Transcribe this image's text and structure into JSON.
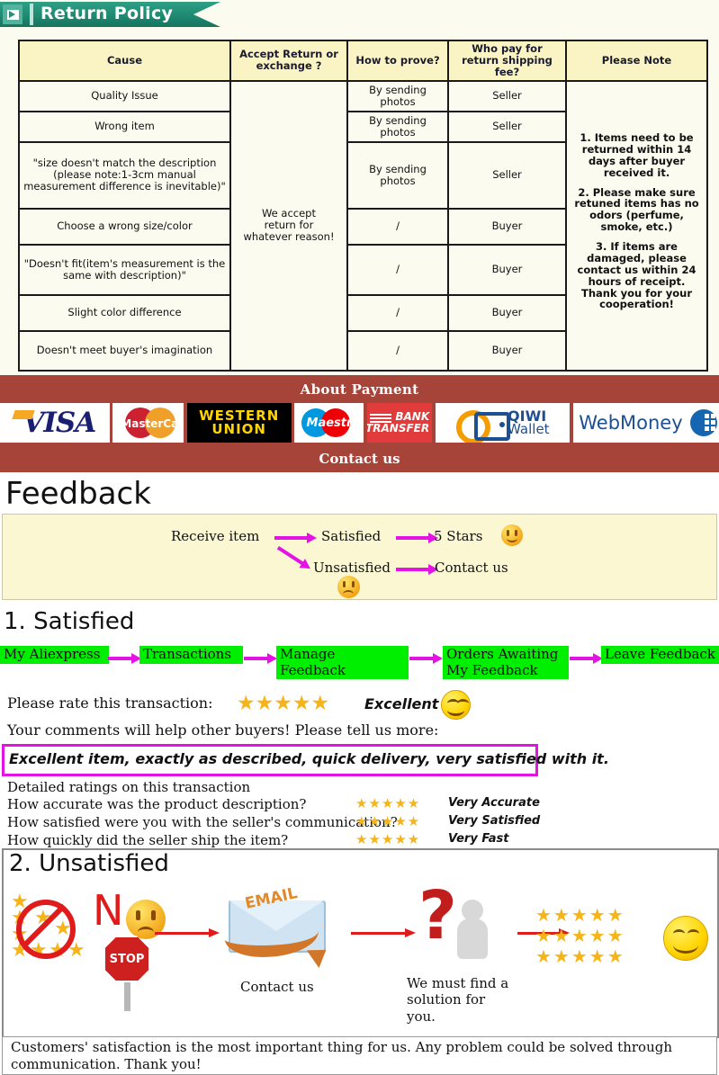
{
  "return_policy": {
    "banner_title": "Return Policy",
    "banner_color": "#1f8a72",
    "table": {
      "headers": [
        "Cause",
        "Accept Return or exchange ?",
        "How to prove?",
        "Who pay for return shipping fee?",
        "Please Note"
      ],
      "accept_cell": "We accept\nreturn for\nwhatever reason!",
      "rows": [
        {
          "cause": "Quality Issue",
          "prove": "By sending photos",
          "who": "Seller"
        },
        {
          "cause": "Wrong item",
          "prove": "By sending photos",
          "who": "Seller"
        },
        {
          "cause": "\"size doesn't match the description (please note:1-3cm manual measurement difference is inevitable)\"",
          "prove": "By sending photos",
          "who": "Seller"
        },
        {
          "cause": "Choose a wrong size/color",
          "prove": "/",
          "who": "Buyer"
        },
        {
          "cause": "\"Doesn't fit(item's measurement is the same with description)\"",
          "prove": "/",
          "who": "Buyer"
        },
        {
          "cause": "Slight color difference",
          "prove": "/",
          "who": "Buyer"
        },
        {
          "cause": "Doesn't meet buyer's imagination",
          "prove": "/",
          "who": "Buyer"
        }
      ],
      "notes": [
        "1. Items need to be returned within 14 days after buyer received it.",
        "2. Please make sure retuned items has no odors (perfume, smoke, etc.)",
        "3. If items are damaged, please contact us within 24 hours of receipt. Thank you for your cooperation!"
      ]
    }
  },
  "payment": {
    "title": "About Payment",
    "contact_title": "Contact us",
    "band_color": "#a7443a",
    "methods": [
      {
        "name": "VISA"
      },
      {
        "name": "MasterCard"
      },
      {
        "name": "WESTERN",
        "line2": "UNION"
      },
      {
        "name": "Maestro"
      },
      {
        "name": "BANK",
        "line2": "TRANSFER"
      },
      {
        "name": "QIWI",
        "line2": "Wallet"
      },
      {
        "name": "WebMoney"
      }
    ]
  },
  "feedback": {
    "heading": "Feedback",
    "flow": {
      "start": "Receive item",
      "satisfied": "Satisfied",
      "satisfied_result": "5 Stars",
      "unsatisfied": "Unsatisfied",
      "unsatisfied_result": "Contact us"
    },
    "satisfied": {
      "section_title": "1. Satisfied",
      "steps": [
        "My Aliexpress",
        "Transactions",
        "Manage Feedback",
        "Orders Awaiting My Feedback",
        "Leave Feedback"
      ],
      "rate_label": "Please rate this transaction:",
      "rate_stars": "★★★★★",
      "rate_word": "Excellent",
      "comments_prompt": "Your comments will help other buyers! Please tell us more:",
      "comment_value": "Excellent item, exactly as described, quick delivery, very satisfied with it.",
      "detailed_title": "Detailed ratings on this transaction",
      "detailed_rows": [
        {
          "question": "How accurate was the product description?",
          "stars": "★★★★★",
          "label": "Very Accurate"
        },
        {
          "question": "How satisfied were you with the seller's communication?",
          "stars": "★★★★★",
          "label": "Very Satisfied"
        },
        {
          "question": "How quickly did the seller ship the item?",
          "stars": "★★★★★",
          "label": "Very Fast"
        }
      ]
    },
    "unsatisfied": {
      "section_title": "2. Unsatisfied",
      "no_letter": "N",
      "stop_label": "STOP",
      "email_label": "EMAIL",
      "contact_caption": "Contact us",
      "solution_caption": "We must find a solution for you.",
      "question_mark": "?",
      "star_rows": [
        "★★★★★",
        "★★★★★",
        "★★★★★"
      ]
    },
    "footer": "Customers' satisfaction is the most important thing for us. Any problem could be solved through communication. Thank you!"
  }
}
